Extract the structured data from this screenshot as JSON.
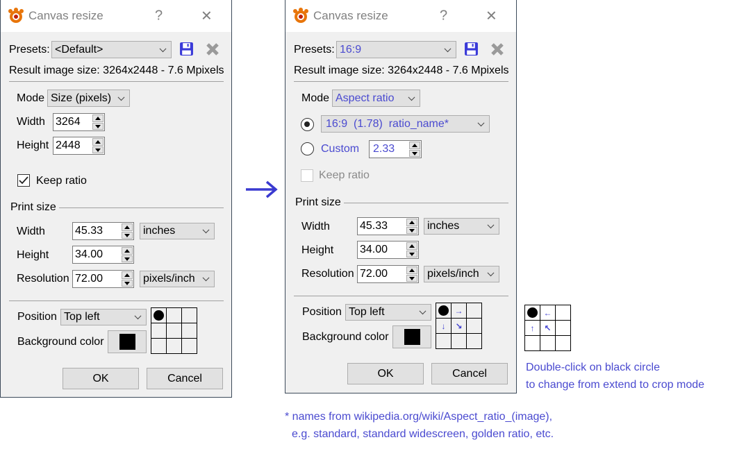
{
  "left_dialog": {
    "title": "Canvas resize",
    "help": "?",
    "close": "✕",
    "presets_label": "Presets:",
    "presets_value": "<Default>",
    "result_size": "Result image size: 3264x2448 - 7.6 Mpixels",
    "mode_label": "Mode",
    "mode_value": "Size (pixels)",
    "width_label": "Width",
    "width_value": "3264",
    "height_label": "Height",
    "height_value": "2448",
    "keep_ratio": "Keep ratio",
    "keep_ratio_checked": true,
    "print_size": "Print size",
    "print_width_label": "Width",
    "print_width": "45.33",
    "width_unit": "inches",
    "print_height_label": "Height",
    "print_height": "34.00",
    "resolution_label": "Resolution",
    "resolution": "72.00",
    "resolution_unit": "pixels/inch",
    "position_label": "Position",
    "position_value": "Top left",
    "bg_label": "Background color",
    "bg_color": "#000000",
    "ok": "OK",
    "cancel": "Cancel"
  },
  "right_dialog": {
    "title": "Canvas resize",
    "help": "?",
    "close": "✕",
    "presets_label": "Presets:",
    "presets_value": "16:9",
    "result_size": "Result image size: 3264x2448 - 7.6 Mpixels",
    "mode_label": "Mode",
    "mode_value": "Aspect ratio",
    "ratio_value": "16:9  (1.78)  ratio_name*",
    "custom_label": "Custom",
    "custom_value": "2.33",
    "keep_ratio": "Keep ratio",
    "keep_ratio_checked": false,
    "print_size": "Print size",
    "print_width_label": "Width",
    "print_width": "45.33",
    "width_unit": "inches",
    "print_height_label": "Height",
    "print_height": "34.00",
    "resolution_label": "Resolution",
    "resolution": "72.00",
    "resolution_unit": "pixels/inch",
    "position_label": "Position",
    "position_value": "Top left",
    "bg_label": "Background color",
    "bg_color": "#000000",
    "grid_arrows": [
      "",
      "→",
      "",
      "↓",
      "↘",
      "",
      "",
      "",
      ""
    ],
    "ok": "OK",
    "cancel": "Cancel"
  },
  "crop_grid_arrows": [
    "",
    "←",
    "",
    "↑",
    "↖",
    "",
    "",
    "",
    ""
  ],
  "annotations": {
    "arrow": "→",
    "note_line1": "Double-click on black circle",
    "note_line2": "to change from extend to crop mode",
    "footnote_line1": "* names from wikipedia.org/wiki/Aspect_ratio_(image),",
    "footnote_line2": "e.g. standard, standard widescreen, golden ratio, etc."
  },
  "colors": {
    "accent": "#4a4ad0"
  }
}
